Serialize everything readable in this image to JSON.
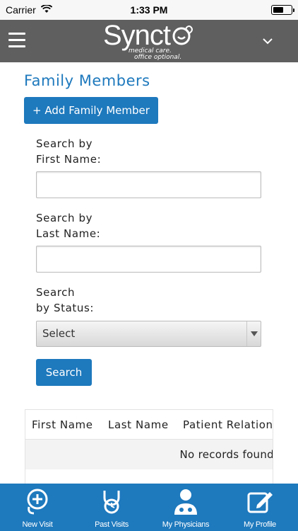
{
  "status_bar": {
    "carrier": "Carrier",
    "time": "1:33 PM"
  },
  "header": {
    "logo_word": "Synct",
    "logo_tagline_1": "medical care.",
    "logo_tagline_2": "office optional."
  },
  "page": {
    "title": "Family Members",
    "add_button": "+ Add Family Member"
  },
  "form": {
    "first_name_label": "Search by\nFirst Name:",
    "first_name_value": "",
    "last_name_label": "Search by\nLast Name:",
    "last_name_value": "",
    "status_label": "Search\nby Status:",
    "status_selected": "Select",
    "search_button": "Search"
  },
  "table": {
    "columns": [
      "First Name",
      "Last Name",
      "Patient Relation"
    ],
    "empty_message": "No records found"
  },
  "tab_bar": {
    "tabs": [
      {
        "label": "New Visit",
        "icon": "stethoscope-plus-icon"
      },
      {
        "label": "Past Visits",
        "icon": "stethoscope-clock-icon"
      },
      {
        "label": "My Physicians",
        "icon": "doctor-icon"
      },
      {
        "label": "My Profile",
        "icon": "edit-profile-icon"
      }
    ]
  },
  "colors": {
    "accent": "#1e79bd",
    "header": "#5f5f5f"
  }
}
